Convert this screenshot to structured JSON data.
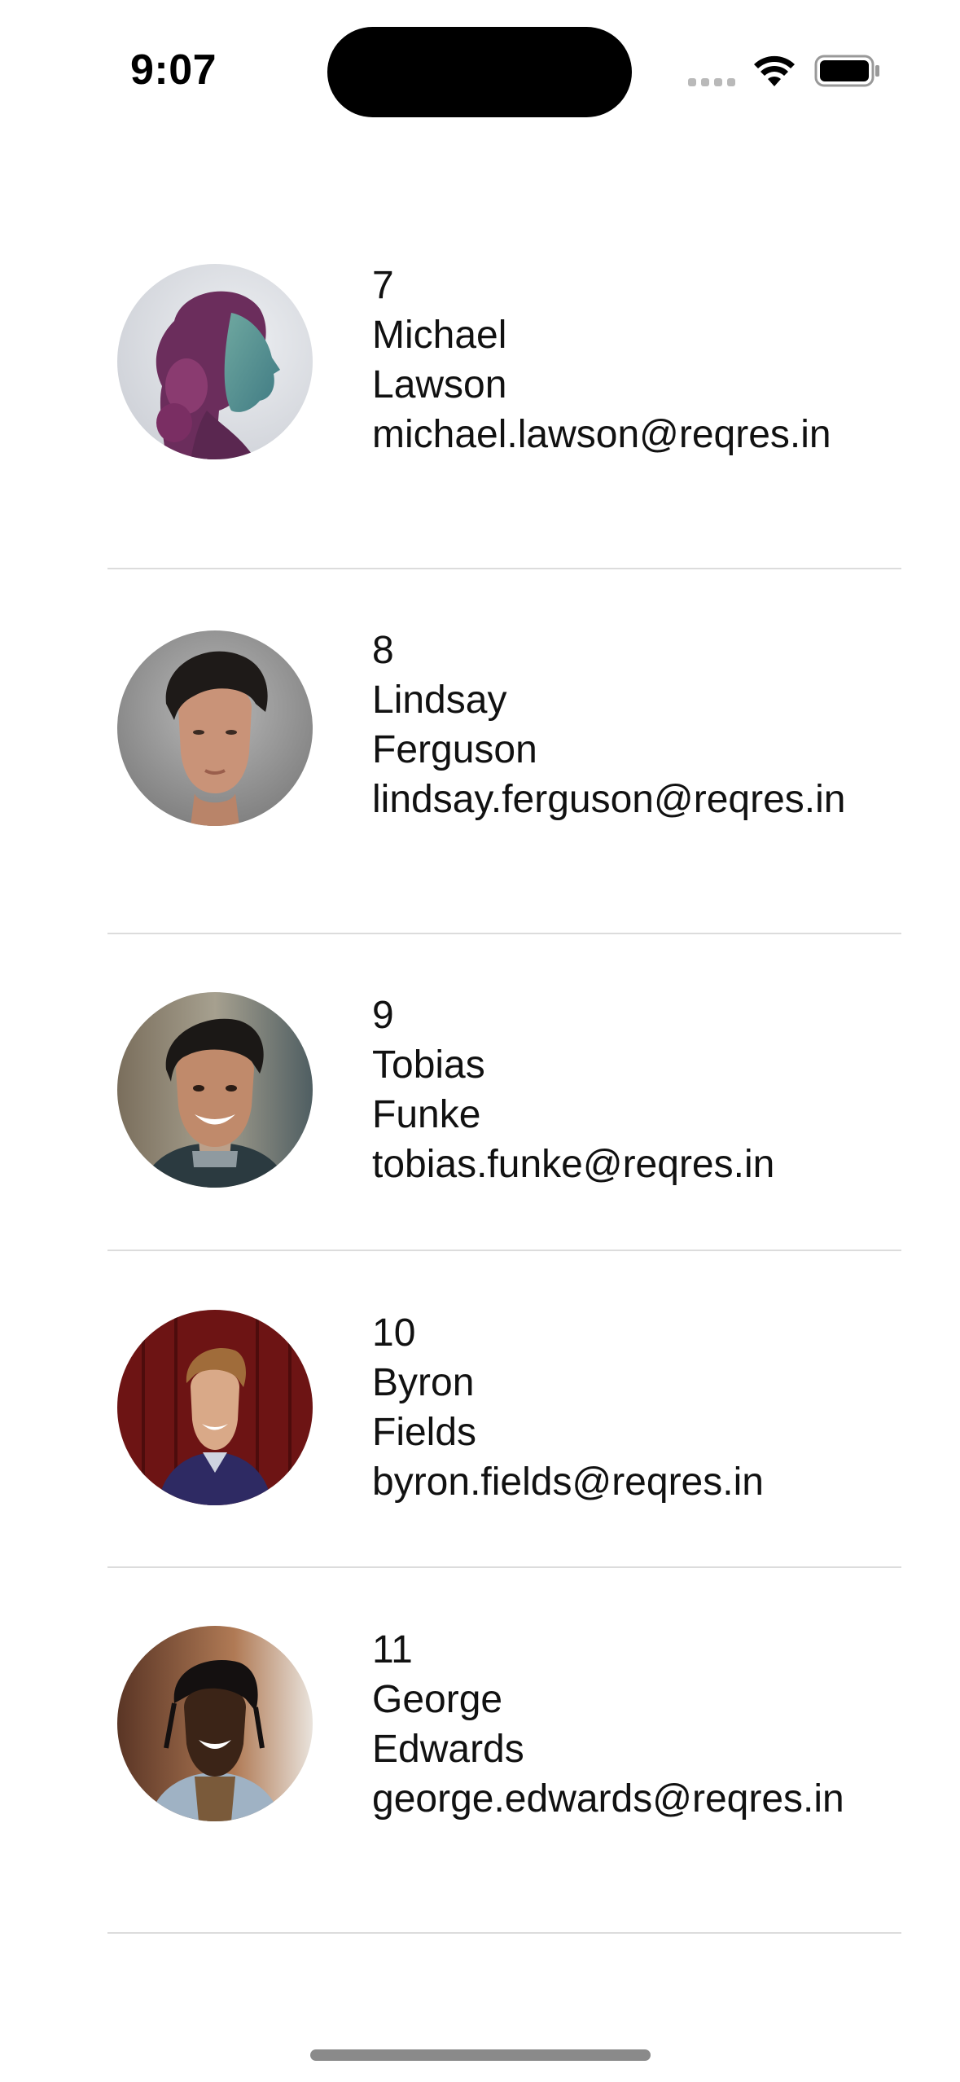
{
  "status_bar": {
    "time": "9:07"
  },
  "users": [
    {
      "id": "7",
      "first_name": "Michael",
      "last_name": "Lawson",
      "email": "michael.lawson@reqres.in",
      "avatar_icon": "avatar-woman-profile-purple"
    },
    {
      "id": "8",
      "first_name": "Lindsay",
      "last_name": "Ferguson",
      "email": "lindsay.ferguson@reqres.in",
      "avatar_icon": "avatar-young-man-gray"
    },
    {
      "id": "9",
      "first_name": "Tobias",
      "last_name": "Funke",
      "email": "tobias.funke@reqres.in",
      "avatar_icon": "avatar-smiling-man-outdoor"
    },
    {
      "id": "10",
      "first_name": "Byron",
      "last_name": "Fields",
      "email": "byron.fields@reqres.in",
      "avatar_icon": "avatar-man-red-wall"
    },
    {
      "id": "11",
      "first_name": "George",
      "last_name": "Edwards",
      "email": "george.edwards@reqres.in",
      "avatar_icon": "avatar-man-street"
    }
  ]
}
